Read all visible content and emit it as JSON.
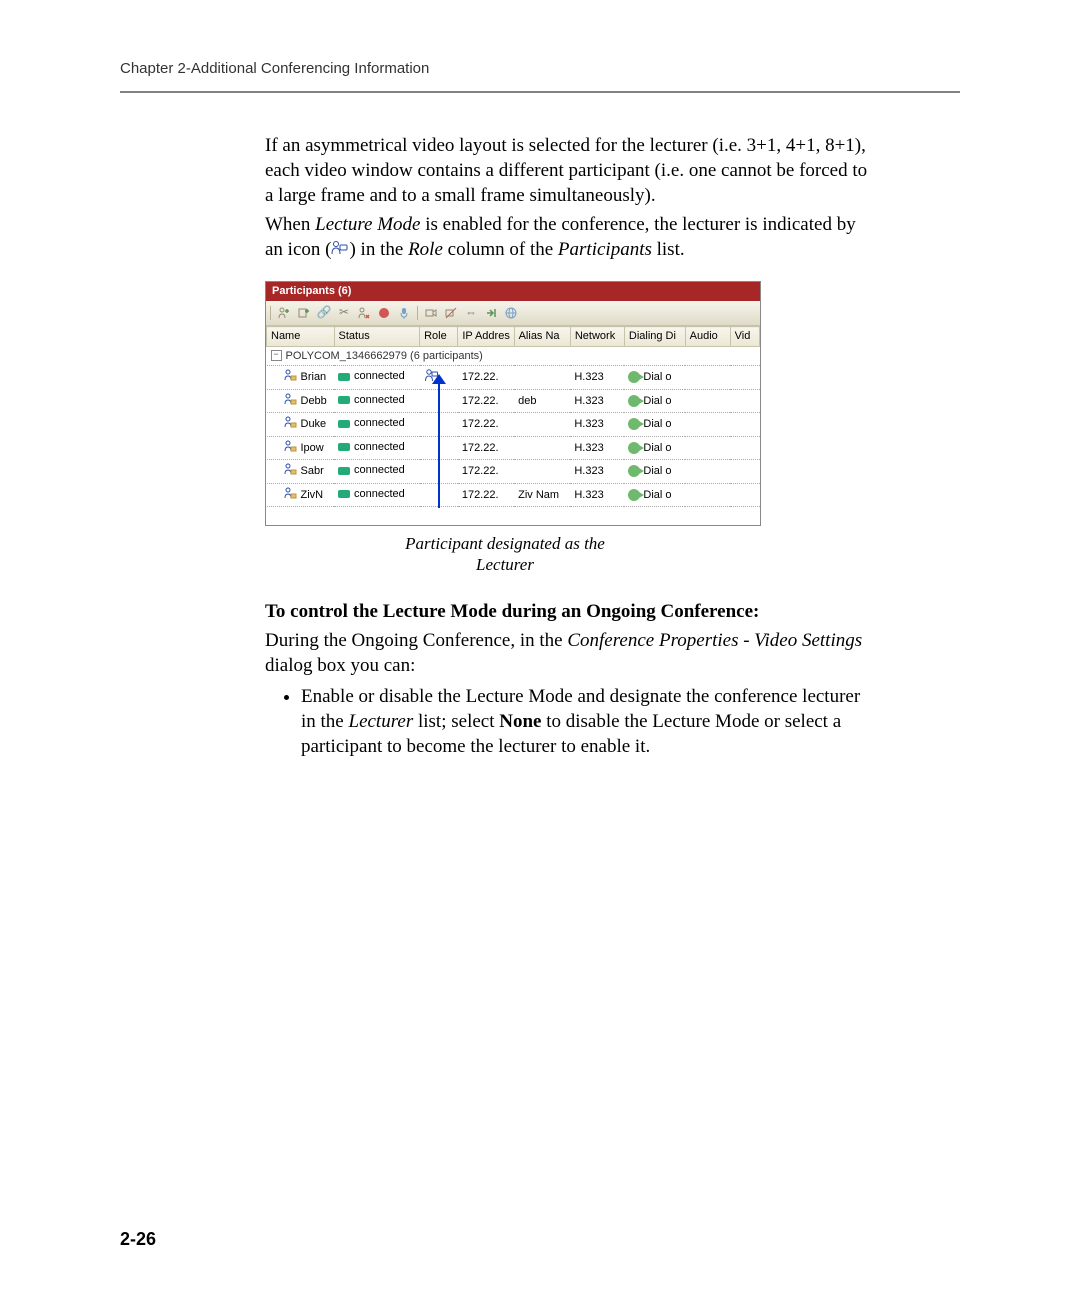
{
  "header": "Chapter 2-Additional Conferencing Information",
  "page_number": "2-26",
  "body": {
    "p1": "If an asymmetrical video layout is selected for the lecturer (i.e. 3+1, 4+1, 8+1), each video window contains a different participant (i.e. one cannot be forced to a large frame and to a small frame simultaneously).",
    "p2a": "When ",
    "p2b": "Lecture Mode",
    "p2c": " is enabled for the conference, the lecturer is indicated by an icon (",
    "p2d": ") in the ",
    "p2e": "Role",
    "p2f": " column of the ",
    "p2g": "Participants",
    "p2h": " list.",
    "caption_l1": "Participant designated as the",
    "caption_l2": "Lecturer",
    "subhead": "To control the Lecture Mode during an Ongoing Conference:",
    "p3a": "During the Ongoing Conference, in the ",
    "p3b": "Conference Properties - Video Settings",
    "p3c": " dialog box you can:",
    "bullet1a": "Enable or disable the Lecture Mode and designate the conference lecturer in the ",
    "bullet1b": "Lecturer",
    "bullet1c": " list; select ",
    "bullet1d": "None",
    "bullet1e": " to disable the Lecture Mode or select a participant to become the lecturer to enable it."
  },
  "screenshot": {
    "title": "Participants (6)",
    "toolbar_icons": [
      "add-participant",
      "add-new",
      "link",
      "scissors",
      "remove",
      "record",
      "mic",
      "camera",
      "mute-all",
      "swap",
      "arrow-in",
      "globe"
    ],
    "columns": {
      "name": "Name",
      "status": "Status",
      "role": "Role",
      "ip": "IP Addres",
      "alias": "Alias Na",
      "network": "Network",
      "dialdir": "Dialing Di",
      "audio": "Audio",
      "vid": "Vid"
    },
    "group_row": "POLYCOM_1346662979 (6 participants)",
    "status_text": "connected",
    "rows": [
      {
        "name": "Brian",
        "role": "lecturer-icon",
        "ip": "172.22.",
        "alias": "",
        "network": "H.323",
        "dial": "Dial o"
      },
      {
        "name": "Debb",
        "role": "",
        "ip": "172.22.",
        "alias": "deb",
        "network": "H.323",
        "dial": "Dial o"
      },
      {
        "name": "Duke",
        "role": "",
        "ip": "172.22.",
        "alias": "",
        "network": "H.323",
        "dial": "Dial o"
      },
      {
        "name": "Ipow",
        "role": "",
        "ip": "172.22.",
        "alias": "",
        "network": "H.323",
        "dial": "Dial o"
      },
      {
        "name": "Sabr",
        "role": "",
        "ip": "172.22.",
        "alias": "",
        "network": "H.323",
        "dial": "Dial o"
      },
      {
        "name": "ZivN",
        "role": "",
        "ip": "172.22.",
        "alias": "Ziv Nam",
        "network": "H.323",
        "dial": "Dial o"
      }
    ]
  }
}
